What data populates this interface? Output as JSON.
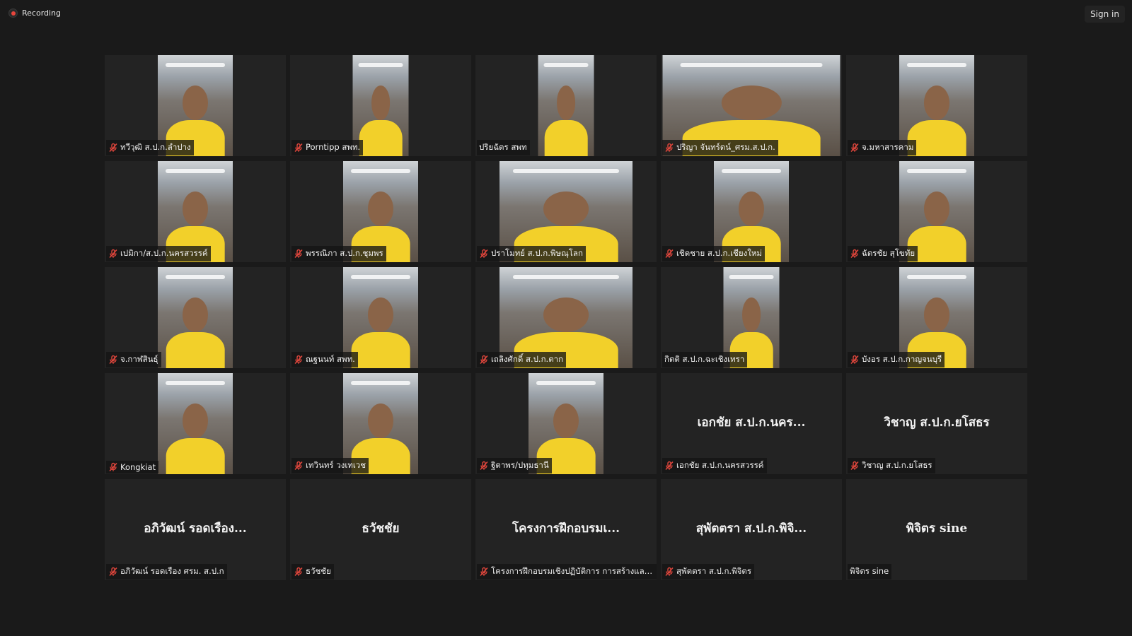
{
  "topbar": {
    "recording_label": "Recording",
    "signin_label": "Sign in"
  },
  "colors": {
    "background": "#1a1a1a",
    "tile": "#232323",
    "muted_icon": "#e0463c",
    "recording_dot": "#e8453c"
  },
  "participants": [
    {
      "label": "ทวีวุฒิ ส.ป.ก.ลำปาง",
      "muted": true,
      "video": true
    },
    {
      "label": "Porntipp สพท.",
      "muted": true,
      "video": true
    },
    {
      "label": "ปริยฉัตร สพท",
      "muted": false,
      "video": true
    },
    {
      "label": "ปริญา จันทร์ตน์_ศรม.ส.ป.ก.",
      "muted": true,
      "video": true
    },
    {
      "label": "จ.มหาสารคาม",
      "muted": true,
      "video": true
    },
    {
      "label": "เปมิกา/ส.ป.ก.นครสวรรค์",
      "muted": true,
      "video": true
    },
    {
      "label": "พรรณิภา ส.ป.ก.ชุมพร",
      "muted": true,
      "video": true
    },
    {
      "label": "ปราโมทย์ ส.ป.ก.พิษณุโลก",
      "muted": true,
      "video": true
    },
    {
      "label": "เชิดชาย ส.ป.ก.เชียงใหม่",
      "muted": true,
      "video": true
    },
    {
      "label": "ฉัตรชัย สุโขทัย",
      "muted": true,
      "video": true
    },
    {
      "label": "จ.กาฬสินธุ์",
      "muted": true,
      "video": true
    },
    {
      "label": "ณฐนนท์ สพท.",
      "muted": true,
      "video": true
    },
    {
      "label": "เถลิงศักดิ์ ส.ป.ก.ตาก",
      "muted": true,
      "video": true
    },
    {
      "label": "กิตติ ส.ป.ก.ฉะเชิงเทรา",
      "muted": false,
      "video": true
    },
    {
      "label": "บังอร ส.ป.ก.กาญจนบุรี",
      "muted": true,
      "video": true
    },
    {
      "label": "Kongkiat",
      "muted": true,
      "video": true
    },
    {
      "label": "เทวินทร์ วงเทเวช",
      "muted": true,
      "video": true
    },
    {
      "label": "ฐิตาพร/ปทุมธานี",
      "muted": true,
      "video": true
    },
    {
      "label": "เอกชัย ส.ป.ก.นครสวรรค์",
      "muted": true,
      "video": false,
      "display_name": "เอกชัย ส.ป.ก.นคร..."
    },
    {
      "label": "วิชาญ ส.ป.ก.ยโสธร",
      "muted": true,
      "video": false,
      "display_name": "วิชาญ ส.ป.ก.ยโสธร"
    },
    {
      "label": "อภิวัฒน์ รอดเรือง ศรม. ส.ป.ก",
      "muted": true,
      "video": false,
      "display_name": "อภิวัฒน์ รอดเรือง..."
    },
    {
      "label": "ธวัชชัย",
      "muted": true,
      "video": false,
      "display_name": "ธวัชชัย"
    },
    {
      "label": "โครงการฝึกอบรมเชิงปฏิบัติการ การสร้างและพั...",
      "muted": true,
      "video": false,
      "display_name": "โครงการฝึกอบรมเ..."
    },
    {
      "label": "สุพัตตรา ส.ป.ก.พิจิตร",
      "muted": true,
      "video": false,
      "display_name": "สุพัตตรา ส.ป.ก.พิจิ..."
    },
    {
      "label": "พิจิตร sine",
      "muted": false,
      "video": false,
      "display_name": "พิจิตร sine"
    }
  ]
}
